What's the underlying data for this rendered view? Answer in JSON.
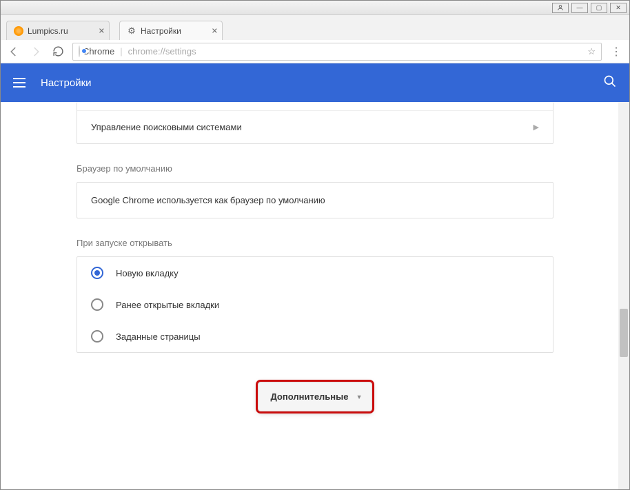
{
  "tabs": [
    {
      "title": "Lumpics.ru",
      "favicon": "orange-circle-icon"
    },
    {
      "title": "Настройки",
      "favicon": "gear-icon"
    }
  ],
  "address_bar": {
    "secure_label": "Chrome",
    "url": "chrome://settings"
  },
  "header": {
    "title": "Настройки"
  },
  "search_engines": {
    "manage_label": "Управление поисковыми системами"
  },
  "default_browser": {
    "section_label": "Браузер по умолчанию",
    "status_text": "Google Chrome используется как браузер по умолчанию"
  },
  "on_startup": {
    "section_label": "При запуске открывать",
    "options": [
      {
        "label": "Новую вкладку",
        "selected": true
      },
      {
        "label": "Ранее открытые вкладки",
        "selected": false
      },
      {
        "label": "Заданные страницы",
        "selected": false
      }
    ]
  },
  "advanced_button_label": "Дополнительные"
}
